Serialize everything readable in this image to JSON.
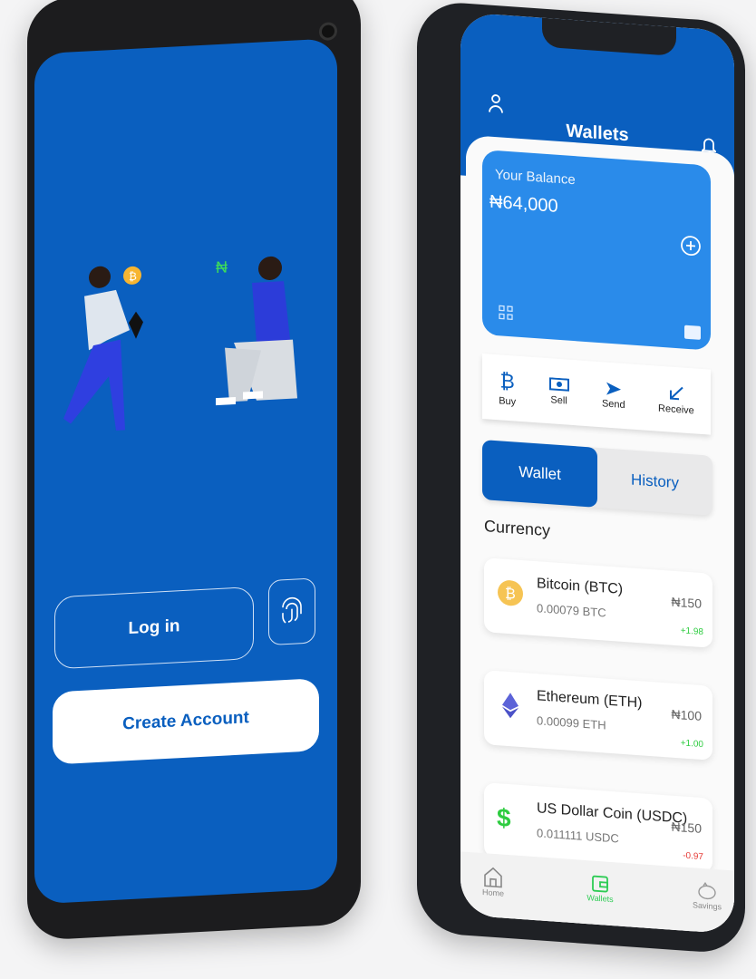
{
  "login_phone": {
    "login_label": "Log in",
    "create_label": "Create Account",
    "naira_symbol": "₦"
  },
  "wallet_phone": {
    "title": "Wallets",
    "balance": {
      "label": "Your Balance",
      "amount": "₦64,000"
    },
    "actions": [
      {
        "label": "Buy",
        "icon": "bitcoin-icon"
      },
      {
        "label": "Sell",
        "icon": "cash-icon"
      },
      {
        "label": "Send",
        "icon": "send-icon"
      },
      {
        "label": "Receive",
        "icon": "receive-arrow-icon"
      }
    ],
    "tabs": [
      {
        "label": "Wallet",
        "active": true
      },
      {
        "label": "History",
        "active": false
      }
    ],
    "section_title": "Currency",
    "currencies": [
      {
        "name": "Bitcoin (BTC)",
        "amount": "0.00079 BTC",
        "price": "₦150",
        "change": "+1.98",
        "change_color": "#2ecc40"
      },
      {
        "name": "Ethereum (ETH)",
        "amount": "0.00099 ETH",
        "price": "₦100",
        "change": "+1.00",
        "change_color": "#2ecc40"
      },
      {
        "name": "US Dollar Coin (USDC)",
        "amount": "0.011111 USDC",
        "price": "₦150",
        "change": "-0.97",
        "change_color": "#e53935"
      }
    ],
    "nav": [
      {
        "label": "Home",
        "active": false
      },
      {
        "label": "Wallets",
        "active": true
      },
      {
        "label": "Savings",
        "active": false
      }
    ]
  },
  "colors": {
    "brand": "#0a5fbf",
    "card": "#2a8bea",
    "positive": "#2ecc40",
    "negative": "#e53935"
  }
}
